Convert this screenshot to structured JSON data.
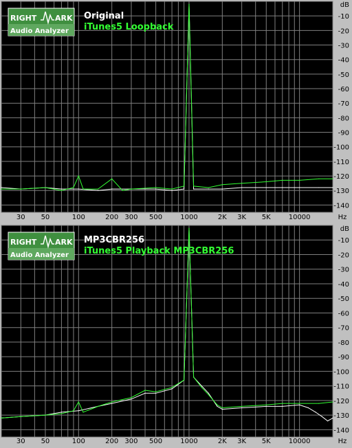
{
  "y_unit": "dB",
  "x_unit": "Hz",
  "logo": {
    "line1_left": "RIGHT",
    "line1_right": "ARK",
    "line2": "Audio Analyzer"
  },
  "colors": {
    "panel_background": "#000000",
    "grid": "#808080",
    "frame": "#c0c0c0",
    "series_white": "#ffffff",
    "series_green": "#33ff33",
    "logo_background": "#3f8f3f",
    "logo_text": "#ffffff"
  },
  "chart_data": [
    {
      "type": "line",
      "x_scale": "log",
      "xlim": [
        20,
        20000
      ],
      "ylim": [
        -145,
        0
      ],
      "grid": true,
      "legend": "top-left",
      "x_tick_labels": [
        "30",
        "50",
        "100",
        "200",
        "300",
        "500",
        "1000",
        "2K",
        "3K",
        "5K",
        "10000",
        "Hz"
      ],
      "y_tick_labels": [
        "dB",
        "-10",
        "-20",
        "-30",
        "-40",
        "-50",
        "-60",
        "-70",
        "-80",
        "-90",
        "-100",
        "-110",
        "-120",
        "-130",
        "-140"
      ],
      "series": [
        {
          "name": "Original",
          "color": "#ffffff",
          "x": [
            20,
            30,
            50,
            70,
            100,
            150,
            200,
            300,
            500,
            700,
            900,
            1000,
            1100,
            1500,
            2000,
            3000,
            5000,
            7000,
            10000,
            15000,
            20000
          ],
          "y": [
            -128,
            -129,
            -128,
            -129,
            -129,
            -130,
            -129,
            -129,
            -129,
            -130,
            -129,
            -2,
            -129,
            -129,
            -129,
            -128,
            -128,
            -128,
            -128,
            -128,
            -128
          ]
        },
        {
          "name": "iTunes5 Loopback",
          "color": "#33ff33",
          "x": [
            20,
            30,
            50,
            70,
            90,
            100,
            110,
            150,
            200,
            250,
            300,
            500,
            700,
            900,
            1000,
            1100,
            1500,
            2000,
            3000,
            5000,
            7000,
            10000,
            15000,
            20000
          ],
          "y": [
            -129,
            -129,
            -128,
            -130,
            -128,
            -120,
            -129,
            -129,
            -122,
            -130,
            -129,
            -128,
            -129,
            -127,
            -2,
            -127,
            -128,
            -126,
            -125,
            -124,
            -123,
            -123,
            -122,
            -122
          ]
        }
      ]
    },
    {
      "type": "line",
      "x_scale": "log",
      "xlim": [
        20,
        20000
      ],
      "ylim": [
        -145,
        0
      ],
      "grid": true,
      "legend": "top-left",
      "x_tick_labels": [
        "30",
        "50",
        "100",
        "200",
        "300",
        "500",
        "1000",
        "2K",
        "3K",
        "5K",
        "10000",
        "Hz"
      ],
      "y_tick_labels": [
        "dB",
        "-10",
        "-20",
        "-30",
        "-40",
        "-50",
        "-60",
        "-70",
        "-80",
        "-90",
        "-100",
        "-110",
        "-120",
        "-130",
        "-140"
      ],
      "series": [
        {
          "name": "MP3CBR256",
          "color": "#ffffff",
          "x": [
            20,
            30,
            50,
            70,
            100,
            150,
            200,
            300,
            400,
            500,
            700,
            900,
            1000,
            1100,
            1300,
            1500,
            1800,
            2000,
            3000,
            5000,
            7000,
            10000,
            12000,
            14000,
            16000,
            18000,
            20000
          ],
          "y": [
            -132,
            -131,
            -130,
            -128,
            -127,
            -124,
            -122,
            -119,
            -115,
            -115,
            -112,
            -106,
            -2,
            -104,
            -110,
            -115,
            -124,
            -126,
            -125,
            -124,
            -124,
            -123,
            -125,
            -128,
            -131,
            -134,
            -132
          ]
        },
        {
          "name": "iTunes5 Playback MP3CBR256",
          "color": "#33ff33",
          "x": [
            20,
            30,
            50,
            70,
            90,
            100,
            110,
            150,
            200,
            300,
            400,
            500,
            700,
            900,
            1000,
            1100,
            1300,
            1500,
            1800,
            2000,
            3000,
            5000,
            7000,
            10000,
            15000,
            20000
          ],
          "y": [
            -132,
            -131,
            -130,
            -129,
            -127,
            -121,
            -128,
            -124,
            -121,
            -118,
            -113,
            -114,
            -111,
            -106,
            -2,
            -104,
            -111,
            -116,
            -123,
            -125,
            -124,
            -123,
            -122,
            -122,
            -122,
            -121
          ]
        }
      ]
    }
  ]
}
